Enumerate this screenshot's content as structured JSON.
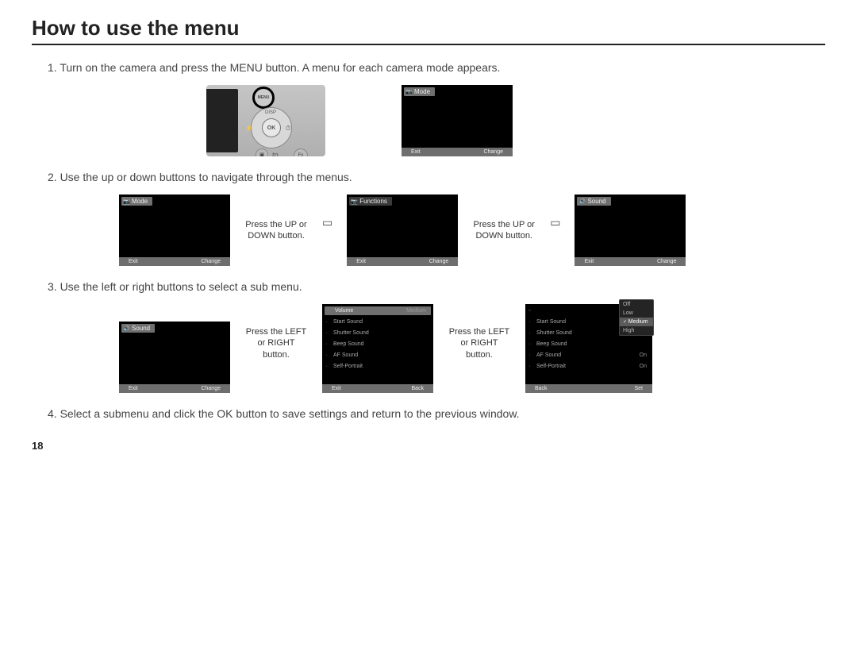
{
  "title": "How to use the menu",
  "page_number": "18",
  "steps": {
    "s1": "1. Turn on the camera and press the MENU button. A menu for each camera mode appears.",
    "s2": "2. Use the up or down buttons to navigate through the menus.",
    "s3": "3. Use the left or right buttons to select a sub menu.",
    "s4": "4. Select a submenu and click the OK button to save settings and return to the previous window."
  },
  "captions": {
    "updown": "Press the UP or DOWN button.",
    "leftright": "Press the LEFT or RIGHT button."
  },
  "camera": {
    "menu": "MENU",
    "ok": "OK",
    "disp": "DISP",
    "fn": "Fn",
    "flash_icon": "⚡",
    "timer_icon": "⏱",
    "play_icon": "▣",
    "squig": "to"
  },
  "panels": {
    "mode": {
      "icon": "📷",
      "label": "Mode"
    },
    "functions": {
      "icon": "📷",
      "label": "Functions"
    },
    "sound": {
      "icon": "🔊",
      "label": "Sound"
    }
  },
  "footer": {
    "exit": "Exit",
    "change": "Change",
    "back": "Back",
    "set": "Set"
  },
  "sound_menu": {
    "volume": {
      "label": "Volume",
      "value": "Medium"
    },
    "start_sound": {
      "label": "Start Sound",
      "value": ""
    },
    "shutter_sound": {
      "label": "Shutter Sound",
      "value": ""
    },
    "beep_sound": {
      "label": "Beep Sound",
      "value": ""
    },
    "af_sound": {
      "label": "AF Sound",
      "value": "On"
    },
    "self_portrait": {
      "label": "Self-Portrait",
      "value": "On"
    }
  },
  "popup": {
    "off": "Off",
    "low": "Low",
    "medium": "Medium",
    "high": "High"
  }
}
